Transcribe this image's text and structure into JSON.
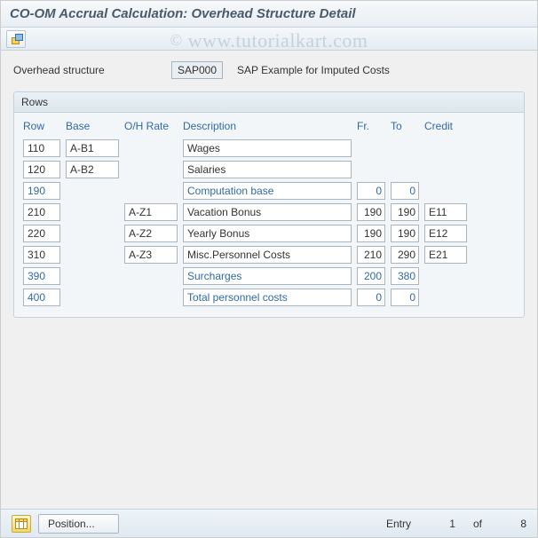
{
  "window": {
    "title": "CO-OM Accrual Calculation: Overhead Structure Detail"
  },
  "watermark": {
    "copy": "©",
    "text": "www.tutorialkart.com"
  },
  "overhead": {
    "label": "Overhead structure",
    "value": "SAP000",
    "desc_label": "SAP Example for Imputed Costs"
  },
  "panel": {
    "title": "Rows",
    "columns": {
      "row": "Row",
      "base": "Base",
      "ohrate": "O/H Rate",
      "description": "Description",
      "fr": "Fr.",
      "to": "To",
      "credit": "Credit"
    },
    "rows": [
      {
        "row": "110",
        "row_link": false,
        "base": "A-B1",
        "ohrate": "",
        "desc": "Wages",
        "desc_link": false,
        "fr": "",
        "to": "",
        "credit": ""
      },
      {
        "row": "120",
        "row_link": false,
        "base": "A-B2",
        "ohrate": "",
        "desc": "Salaries",
        "desc_link": false,
        "fr": "",
        "to": "",
        "credit": ""
      },
      {
        "row": "190",
        "row_link": true,
        "base": "",
        "ohrate": "",
        "desc": "Computation base",
        "desc_link": true,
        "fr": "0",
        "to": "0",
        "credit": ""
      },
      {
        "row": "210",
        "row_link": false,
        "base": "",
        "ohrate": "A-Z1",
        "desc": "Vacation Bonus",
        "desc_link": false,
        "fr": "190",
        "to": "190",
        "credit": "E11"
      },
      {
        "row": "220",
        "row_link": false,
        "base": "",
        "ohrate": "A-Z2",
        "desc": "Yearly Bonus",
        "desc_link": false,
        "fr": "190",
        "to": "190",
        "credit": "E12"
      },
      {
        "row": "310",
        "row_link": false,
        "base": "",
        "ohrate": "A-Z3",
        "desc": "Misc.Personnel Costs",
        "desc_link": false,
        "fr": "210",
        "to": "290",
        "credit": "E21"
      },
      {
        "row": "390",
        "row_link": true,
        "base": "",
        "ohrate": "",
        "desc": "Surcharges",
        "desc_link": true,
        "fr": "200",
        "to": "380",
        "credit": ""
      },
      {
        "row": "400",
        "row_link": true,
        "base": "",
        "ohrate": "",
        "desc": "Total personnel costs",
        "desc_link": true,
        "fr": "0",
        "to": "0",
        "credit": ""
      }
    ]
  },
  "footer": {
    "position_label": "Position...",
    "entry_label": "Entry",
    "entry_current": "1",
    "entry_of_label": "of",
    "entry_total": "8"
  }
}
